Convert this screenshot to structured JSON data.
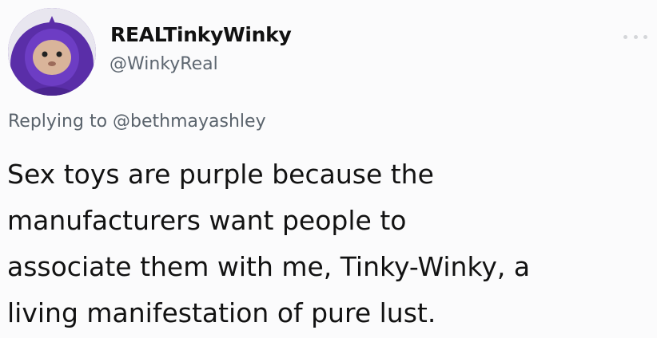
{
  "tweet": {
    "display_name": "REALTinkyWinky",
    "handle": "@WinkyReal",
    "reply_prefix": "Replying to",
    "reply_mention": "@bethmayashley",
    "text_lines": [
      "Sex toys are purple because the",
      "manufacturers want people to",
      "associate them with me, Tinky-Winky, a",
      "living manifestation of pure lust."
    ],
    "avatar_icon": "teletubby-avatar-icon",
    "more_icon": "more-options-icon"
  },
  "colors": {
    "avatar_purple": "#6a3fb1",
    "text": "#121212",
    "muted": "#5a636c"
  }
}
